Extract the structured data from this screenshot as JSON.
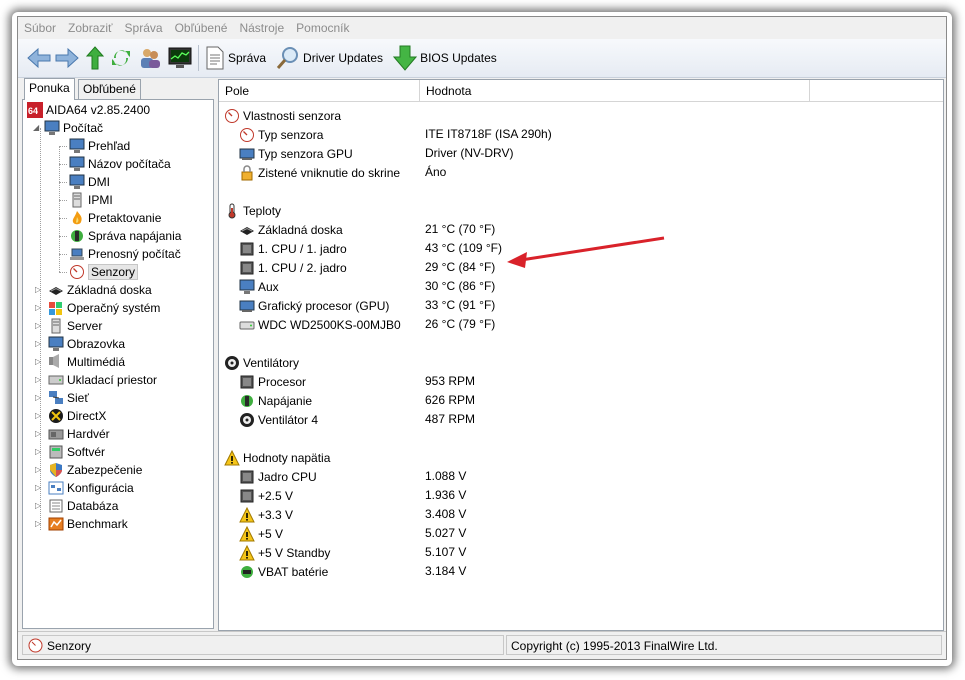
{
  "menu": [
    "Súbor",
    "Zobraziť",
    "Správa",
    "Obľúbené",
    "Nástroje",
    "Pomocník"
  ],
  "toolbar": {
    "report_label": "Správa",
    "driver_label": "Driver Updates",
    "bios_label": "BIOS Updates"
  },
  "left_tabs": {
    "menu": "Ponuka",
    "favorites": "Obľúbené"
  },
  "tree": {
    "root": "AIDA64 v2.85.2400",
    "computer": "Počítač",
    "computer_children": [
      "Prehľad",
      "Názov počítača",
      "DMI",
      "IPMI",
      "Pretaktovanie",
      "Správa napájania",
      "Prenosný počítač",
      "Senzory"
    ],
    "top_items": [
      "Základná doska",
      "Operačný systém",
      "Server",
      "Obrazovka",
      "Multimédiá",
      "Ukladací priestor",
      "Sieť",
      "DirectX",
      "Hardvér",
      "Softvér",
      "Zabezpečenie",
      "Konfigurácia",
      "Databáza",
      "Benchmark"
    ]
  },
  "columns": {
    "field": "Pole",
    "value": "Hodnota"
  },
  "sections": {
    "sensor_props": {
      "title": "Vlastnosti senzora",
      "rows": [
        {
          "label": "Typ senzora",
          "value": "ITE IT8718F  (ISA 290h)"
        },
        {
          "label": "Typ senzora GPU",
          "value": "Driver  (NV-DRV)"
        },
        {
          "label": "Zistené vniknutie do skrine",
          "value": "Áno"
        }
      ]
    },
    "temps": {
      "title": "Teploty",
      "rows": [
        {
          "label": "Základná doska",
          "value": "21 °C  (70 °F)"
        },
        {
          "label": "1. CPU / 1. jadro",
          "value": "43 °C  (109 °F)"
        },
        {
          "label": "1. CPU / 2. jadro",
          "value": "29 °C  (84 °F)"
        },
        {
          "label": "Aux",
          "value": "30 °C  (86 °F)"
        },
        {
          "label": "Grafický procesor (GPU)",
          "value": "33 °C  (91 °F)"
        },
        {
          "label": "WDC WD2500KS-00MJB0",
          "value": "26 °C  (79 °F)"
        }
      ]
    },
    "fans": {
      "title": "Ventilátory",
      "rows": [
        {
          "label": "Procesor",
          "value": "953 RPM"
        },
        {
          "label": "Napájanie",
          "value": "626 RPM"
        },
        {
          "label": "Ventilátor 4",
          "value": "487 RPM"
        }
      ]
    },
    "voltages": {
      "title": "Hodnoty napätia",
      "rows": [
        {
          "label": "Jadro CPU",
          "value": "1.088 V"
        },
        {
          "label": "+2.5 V",
          "value": "1.936 V"
        },
        {
          "label": "+3.3 V",
          "value": "3.408 V"
        },
        {
          "label": "+5 V",
          "value": "5.027 V"
        },
        {
          "label": "+5 V Standby",
          "value": "5.107 V"
        },
        {
          "label": "VBAT batérie",
          "value": "3.184 V"
        }
      ]
    }
  },
  "status": {
    "left": "Senzory",
    "right": "Copyright (c) 1995-2013 FinalWire Ltd."
  },
  "colors": {
    "arrow": "#d9222a",
    "menu_text": "#8c8c8c",
    "selection": "#e6e6e6"
  }
}
